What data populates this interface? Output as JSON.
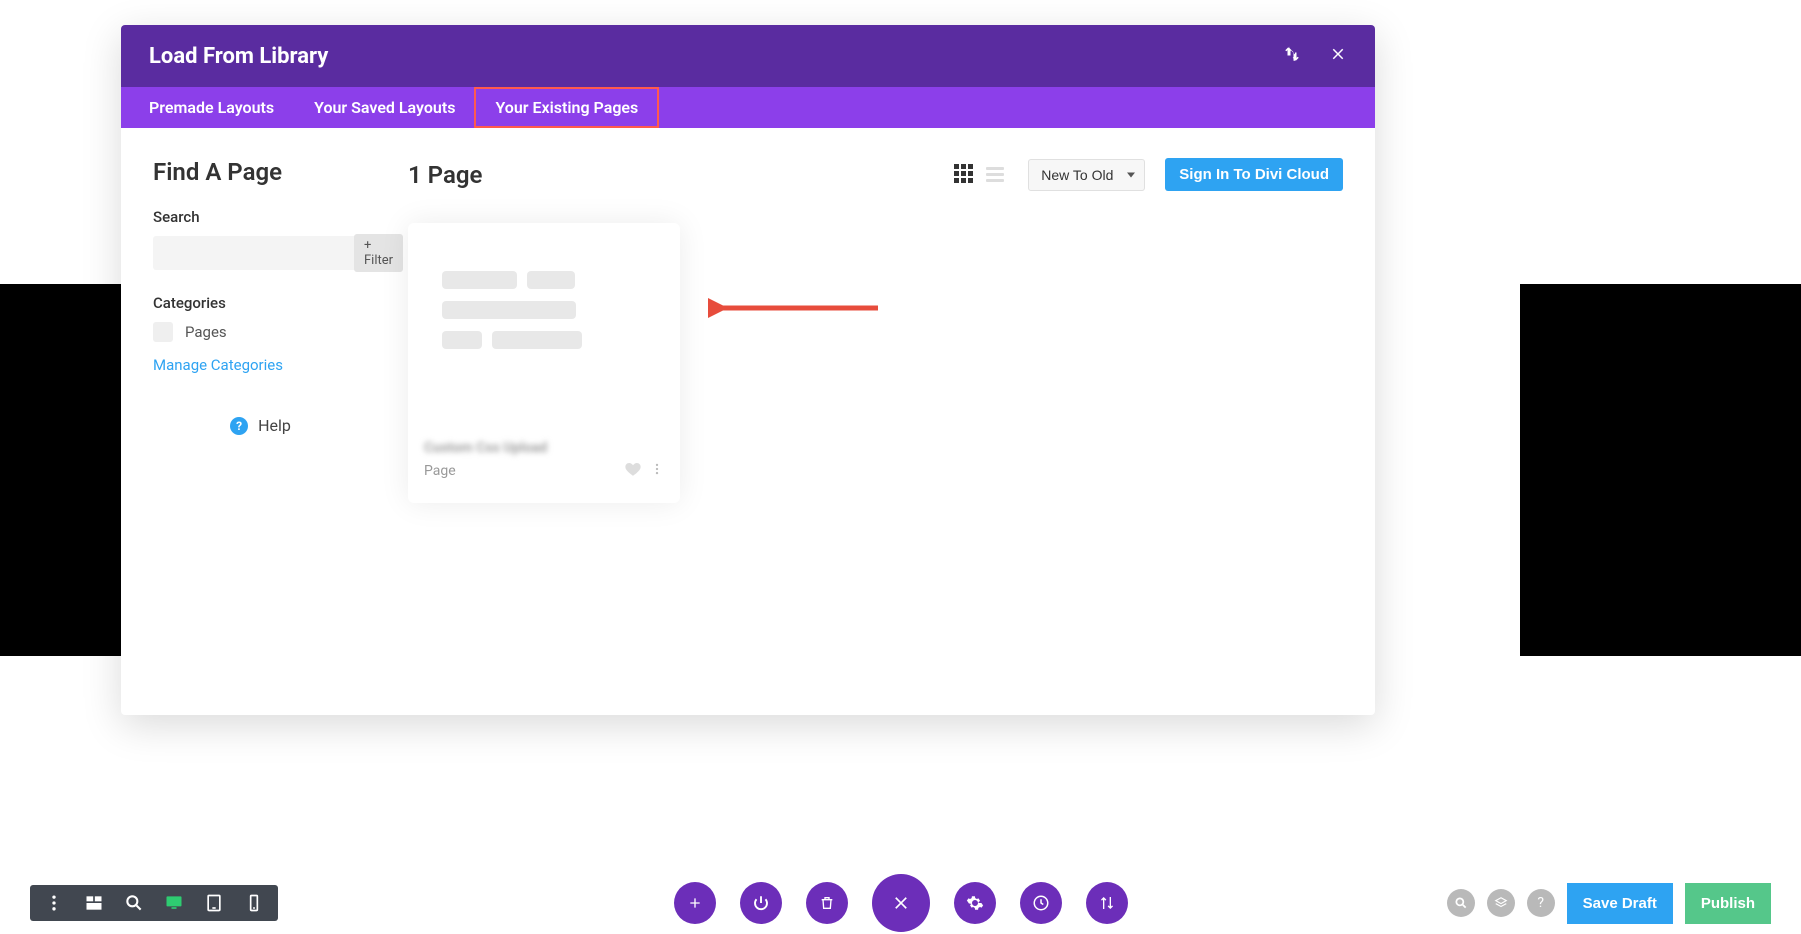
{
  "modal": {
    "title": "Load From Library",
    "tabs": {
      "premade": "Premade Layouts",
      "saved": "Your Saved Layouts",
      "existing": "Your Existing Pages"
    }
  },
  "sidebar": {
    "title": "Find A Page",
    "search_label": "Search",
    "search_placeholder": "",
    "filter_label": "+ Filter",
    "categories_label": "Categories",
    "categories": [
      "Pages"
    ],
    "manage_label": "Manage Categories",
    "help_label": "Help"
  },
  "main": {
    "count_label": "1 Page",
    "sort_value": "New To Old",
    "signin_label": "Sign In To Divi Cloud",
    "card_title": "Custom Css Upload",
    "card_type": "Page"
  },
  "bottombar": {
    "save_draft": "Save Draft",
    "publish": "Publish"
  }
}
